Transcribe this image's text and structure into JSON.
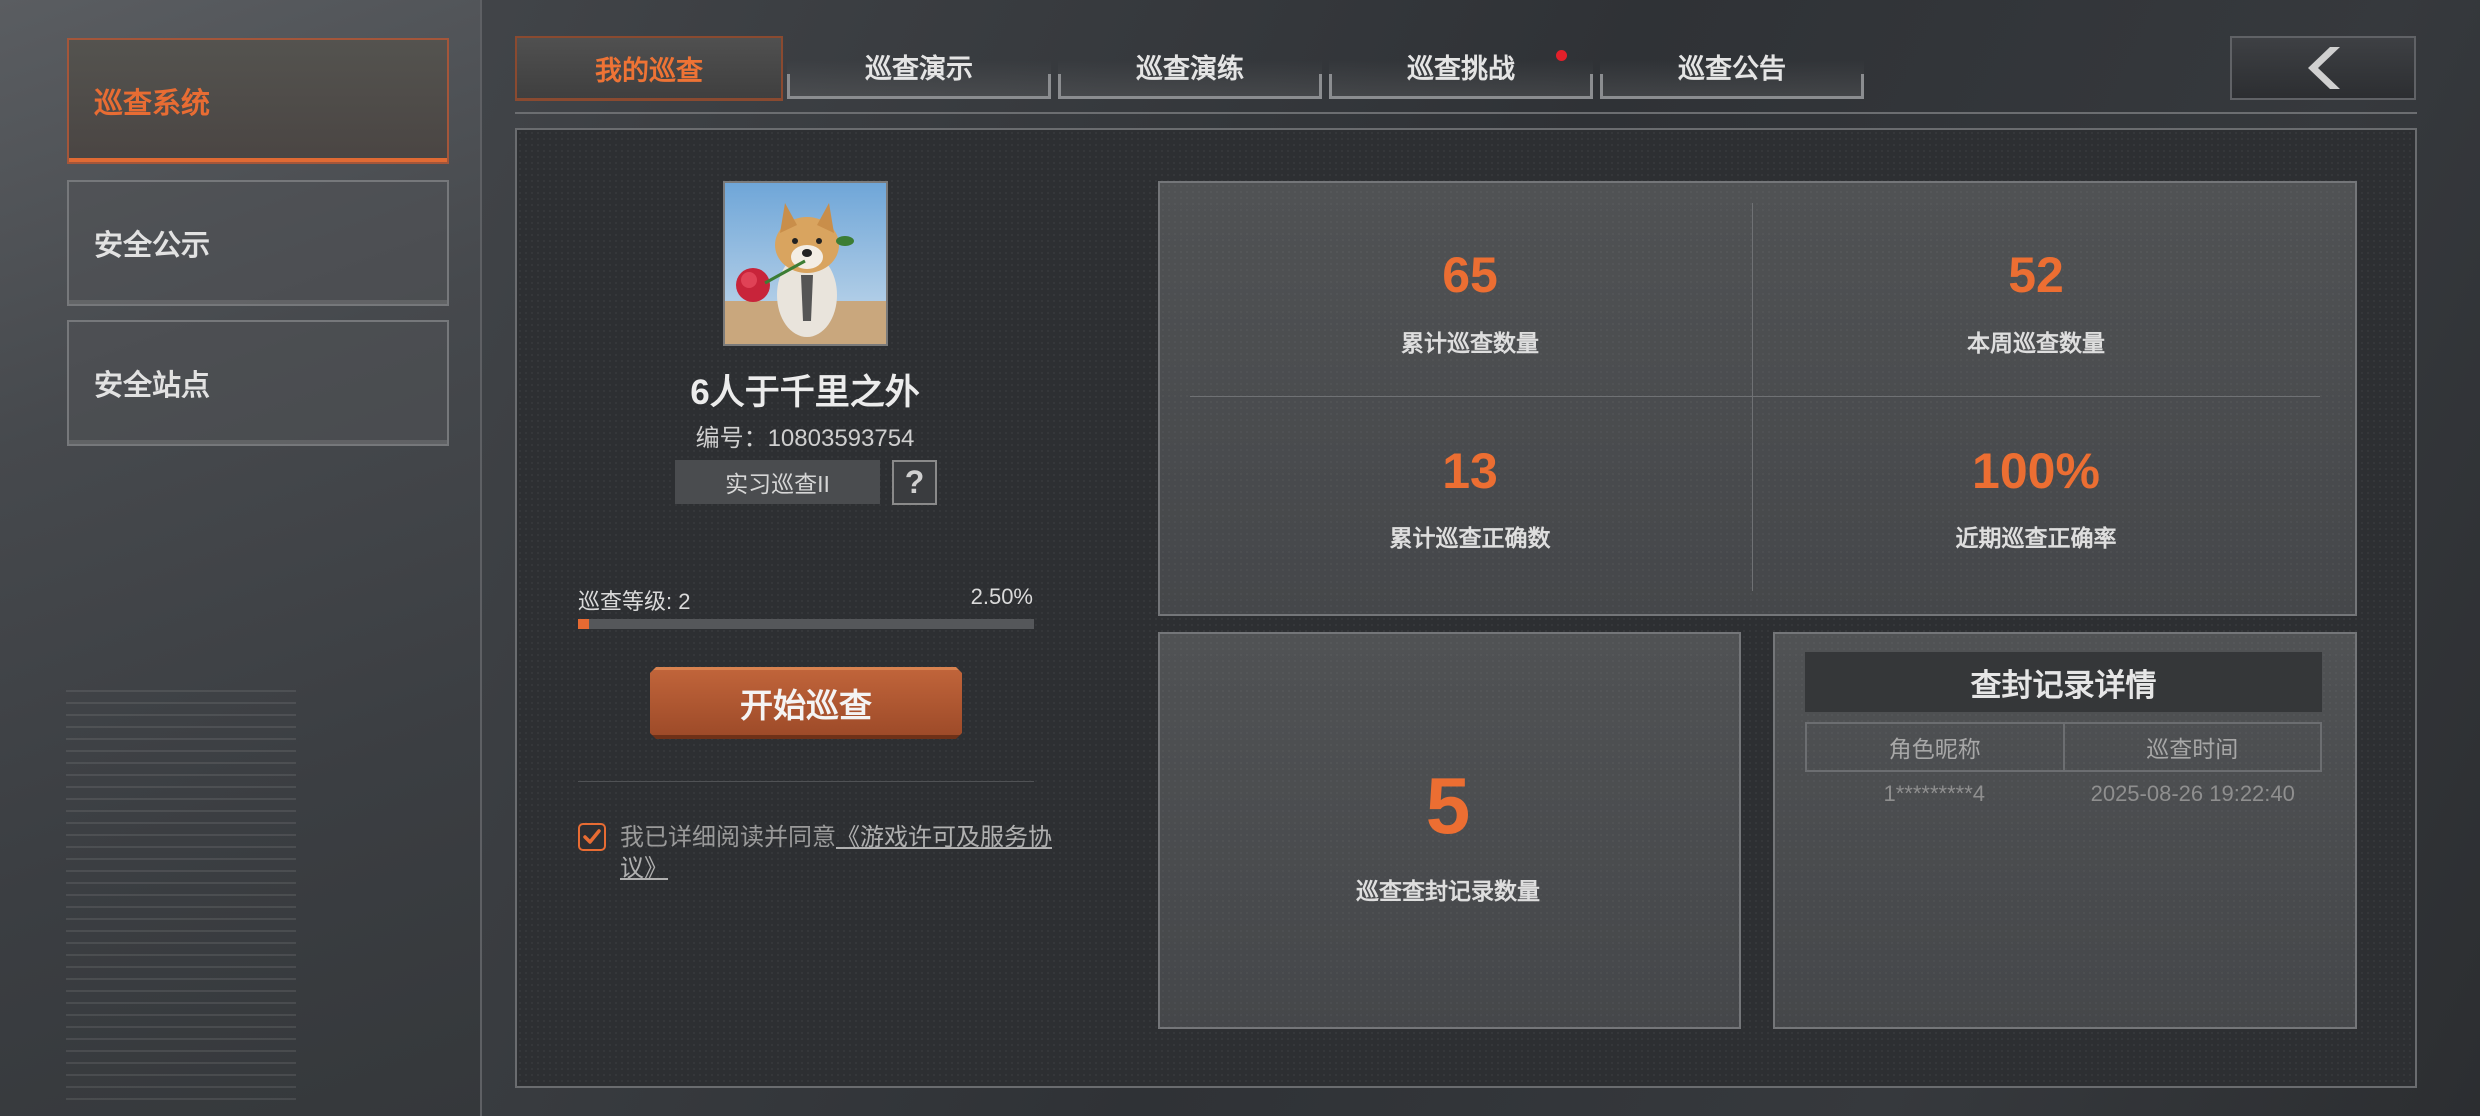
{
  "sidebar": {
    "items": [
      {
        "label": "巡查系统",
        "active": true
      },
      {
        "label": "安全公示",
        "active": false
      },
      {
        "label": "安全站点",
        "active": false
      }
    ]
  },
  "tabs": [
    {
      "label": "我的巡查",
      "active": true,
      "badge": false
    },
    {
      "label": "巡查演示",
      "active": false,
      "badge": false
    },
    {
      "label": "巡查演练",
      "active": false,
      "badge": false
    },
    {
      "label": "巡查挑战",
      "active": false,
      "badge": true
    },
    {
      "label": "巡查公告",
      "active": false,
      "badge": false
    }
  ],
  "back_button_icon": "chevron-left-icon",
  "profile": {
    "avatar_icon": "dog-with-rose-avatar",
    "name": "6人于千里之外",
    "id_text": "编号：10803593754",
    "rank": "实习巡查II",
    "help_glyph": "?"
  },
  "level": {
    "label": "巡查等级: 2",
    "percent_text": "2.50%",
    "progress": 0.025
  },
  "start_button": "开始巡查",
  "agreement": {
    "checked": true,
    "text": "我已详细阅读并同意",
    "link": "《游戏许可及服务协议》"
  },
  "stats": [
    {
      "value": "65",
      "label": "累计巡查数量"
    },
    {
      "value": "52",
      "label": "本周巡查数量"
    },
    {
      "value": "13",
      "label": "累计巡查正确数"
    },
    {
      "value": "100%",
      "label": "近期巡查正确率"
    }
  ],
  "ban_count": {
    "value": "5",
    "label": "巡查查封记录数量"
  },
  "ban_detail": {
    "title": "查封记录详情",
    "columns": [
      "角色昵称",
      "巡查时间"
    ],
    "rows": [
      [
        "1*********4",
        "2025-08-26 19:22:40"
      ]
    ]
  },
  "colors": {
    "accent": "#ec6e32",
    "badge": "#e2202a",
    "panel": "#2d2f32"
  }
}
